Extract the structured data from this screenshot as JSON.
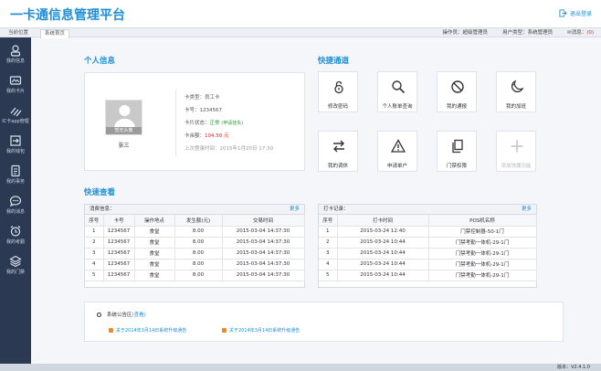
{
  "header": {
    "title": "一卡通信息管理平台",
    "logout": "退出登录"
  },
  "subbar": {
    "location": "当前位置",
    "tab": "系统首页",
    "operator": "操作员：超级管理员",
    "user_type": "用户类型：系统管理员",
    "message": "消息：",
    "message_count": "(0)"
  },
  "sidebar": {
    "items": [
      {
        "label": "我的信息",
        "icon": "user-icon"
      },
      {
        "label": "我的卡片",
        "icon": "card-icon"
      },
      {
        "label": "IC卡app管理",
        "icon": "link-icon"
      },
      {
        "label": "我的钱包",
        "icon": "login-icon"
      },
      {
        "label": "我的事务",
        "icon": "document-icon"
      },
      {
        "label": "我的消息",
        "icon": "chat-icon"
      },
      {
        "label": "我的考勤",
        "icon": "alarm-clock-icon"
      },
      {
        "label": "我的门禁",
        "icon": "layers-icon"
      }
    ]
  },
  "personal": {
    "heading": "个人信息",
    "avatar_caption": "暂无头像",
    "name": "张三",
    "card_type": "卡类型：员工卡",
    "card_no": "卡号：1234567",
    "status_label": "卡片状态：",
    "status_value": "正常",
    "status_action": "(申请挂失)",
    "balance_label": "卡余额：",
    "balance_value": "104.50",
    "balance_unit": "元",
    "login_time": "上次登录时间：2015年1月20日 17:30"
  },
  "quick": {
    "heading": "快捷通道",
    "tiles": [
      {
        "label": "修改密码",
        "icon": "lock-icon",
        "disabled": false
      },
      {
        "label": "个人账单查询",
        "icon": "search-icon",
        "disabled": false
      },
      {
        "label": "我的通报",
        "icon": "ban-icon",
        "disabled": false
      },
      {
        "label": "我的加班",
        "icon": "moon-icon",
        "disabled": false
      },
      {
        "label": "我的调休",
        "icon": "swap-icon",
        "disabled": false
      },
      {
        "label": "申请单户",
        "icon": "warning-icon",
        "disabled": false
      },
      {
        "label": "门禁权限",
        "icon": "copy-icon",
        "disabled": false
      },
      {
        "label": "添加快捷功能",
        "icon": "plus-icon",
        "disabled": true
      }
    ]
  },
  "lookup": {
    "heading": "快速查看"
  },
  "consumption": {
    "caption": "消费信息：",
    "more": "更多",
    "columns": [
      "序号",
      "卡号",
      "操作地点",
      "发生额(元)",
      "交易时间"
    ],
    "rows": [
      [
        "1",
        "1234567",
        "食堂",
        "8.00",
        "2015-03-04 14:37:30"
      ],
      [
        "2",
        "1234567",
        "食堂",
        "8.00",
        "2015-03-04 14:37:30"
      ],
      [
        "3",
        "1234567",
        "食堂",
        "8.00",
        "2015-03-04 14:37:30"
      ],
      [
        "4",
        "1234567",
        "食堂",
        "8.00",
        "2015-03-04 14:37:30"
      ],
      [
        "5",
        "1234567",
        "食堂",
        "8.00",
        "2015-03-04 14:37:30"
      ]
    ]
  },
  "punch": {
    "caption": "打卡记录：",
    "more": "更多",
    "columns": [
      "序号",
      "打卡时间",
      "POS机名称"
    ],
    "rows": [
      [
        "1",
        "2015-03-24 12:40",
        "门禁控制器-50-1门"
      ],
      [
        "2",
        "2015-03-24 10:44",
        "门禁考勤一体机-29-1门"
      ],
      [
        "3",
        "2015-03-24 10:44",
        "门禁考勤一体机-29-1门"
      ],
      [
        "4",
        "2015-03-24 10:44",
        "门禁考勤一体机-29-1门"
      ],
      [
        "5",
        "2015-03-24 10:44",
        "门禁考勤一体机-29-1门"
      ]
    ]
  },
  "notice": {
    "title": "系统公告区",
    "view": "(查看)",
    "items": [
      "关于2014年3月14日系统升级通告",
      "关于2014年3月14日系统升级通告"
    ]
  },
  "footer": {
    "version": "版本：V2.4.1.0"
  },
  "colors": {
    "accent": "#1f8fd6",
    "sidebar": "#2b3a52",
    "alert": "#d9262c",
    "ok": "#2a9d36"
  }
}
